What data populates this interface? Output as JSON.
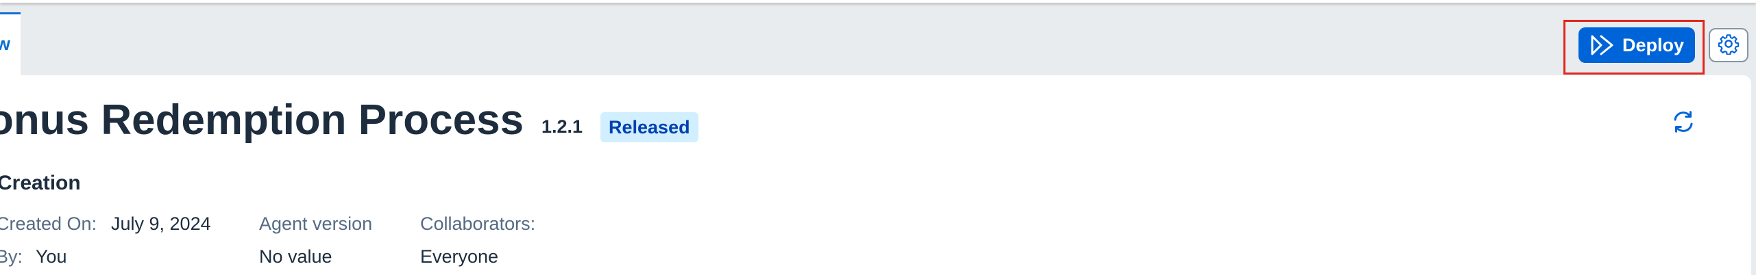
{
  "tabs": [
    {
      "label": "w",
      "active": true
    }
  ],
  "toolbar": {
    "deploy_label": "Deploy",
    "deploy_icon": "double-chevron-right-icon",
    "settings_icon": "gear-icon"
  },
  "header": {
    "title": "onus Redemption Process",
    "version": "1.2.1",
    "status": "Released",
    "refresh_icon": "refresh-icon"
  },
  "creation": {
    "section_title": "Creation",
    "created_on_label": "Created On:",
    "created_on_value": "July 9, 2024",
    "by_label": "By:",
    "by_value": "You",
    "agent_version_label": "Agent version",
    "agent_version_value": "No value",
    "collaborators_label": "Collaborators:",
    "collaborators_value": "Everyone"
  },
  "colors": {
    "accent": "#0064d9",
    "highlight": "#e1261c",
    "badge_bg": "#d1efff",
    "badge_text": "#0040b0",
    "text": "#1d2d3e",
    "label_text": "#556b82"
  }
}
